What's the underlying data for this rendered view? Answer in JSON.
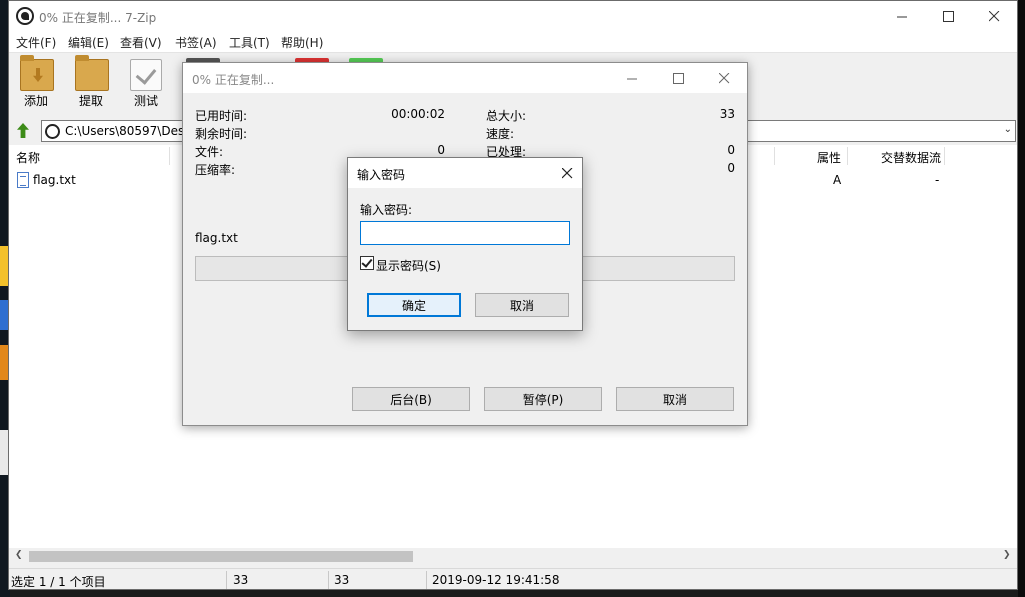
{
  "main_window": {
    "title": "0% 正在复制... 7-Zip",
    "menu": [
      "文件(F)",
      "编辑(E)",
      "查看(V)",
      "书签(A)",
      "工具(T)",
      "帮助(H)"
    ],
    "toolbar": {
      "add_label": "添加",
      "extract_label": "提取",
      "test_label": "测试"
    },
    "address": "C:\\Users\\80597\\Desk",
    "columns": {
      "name": "名称",
      "attributes": "属性",
      "alt_streams": "交替数据流"
    },
    "files": [
      {
        "name": "flag.txt",
        "attributes": "A",
        "alt_streams": "-"
      }
    ],
    "status": {
      "selection": "选定 1 / 1 个项目",
      "size": "33",
      "packed": "33",
      "modified": "2019-09-12 19:41:58"
    }
  },
  "progress_dialog": {
    "title": "0% 正在复制...",
    "elapsed_label": "已用时间:",
    "elapsed_value": "00:00:02",
    "remaining_label": "剩余时间:",
    "files_label": "文件:",
    "files_value": "0",
    "ratio_label": "压缩率:",
    "total_size_label": "总大小:",
    "total_size_value": "33",
    "speed_label": "速度:",
    "processed_label": "已处理:",
    "processed_value": "0",
    "packed_value": "0",
    "current_file": "flag.txt",
    "progress_fraction": 0,
    "background_button": "后台(B)",
    "pause_button": "暂停(P)",
    "cancel_button": "取消"
  },
  "password_dialog": {
    "title": "输入密码",
    "prompt_label": "输入密码:",
    "password_value": "",
    "show_password_label": "显示密码(S)",
    "show_password_checked": true,
    "ok_button": "确定",
    "cancel_button": "取消"
  },
  "colors": {
    "accent": "#0078d7",
    "progress": "#06b025",
    "folder": "#d9a84d"
  }
}
